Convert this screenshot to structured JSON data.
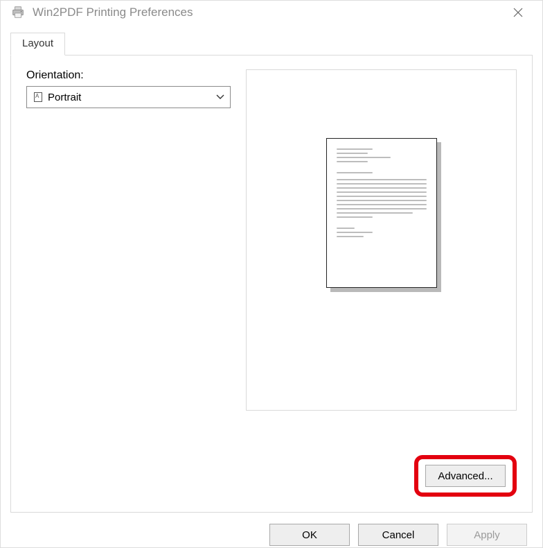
{
  "window": {
    "title": "Win2PDF Printing Preferences"
  },
  "tabs": [
    {
      "label": "Layout"
    }
  ],
  "orientation": {
    "label": "Orientation:",
    "value": "Portrait"
  },
  "buttons": {
    "advanced": "Advanced...",
    "ok": "OK",
    "cancel": "Cancel",
    "apply": "Apply"
  }
}
